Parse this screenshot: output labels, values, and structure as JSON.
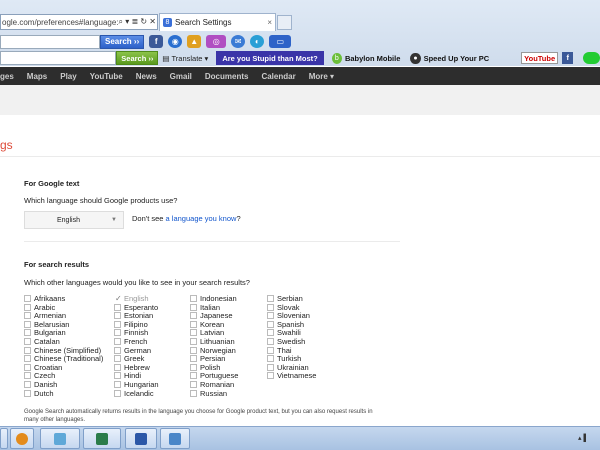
{
  "browser": {
    "address": "ogle.com/preferences#language:",
    "address_icons": "⌕ ▾ ≣ ↻ ✕",
    "tab_title": "Search Settings",
    "tab_close": "×"
  },
  "toolbar1": {
    "search_button": "Search ›› "
  },
  "toolbar2": {
    "search_button": "Search ››",
    "translate": "Translate ▾",
    "stupid_button": "Are you Stupid than Most?",
    "babylon": "Babylon Mobile",
    "speed": "Speed Up Your PC",
    "youtube": "YouTube"
  },
  "google_bar": [
    "ges",
    "Maps",
    "Play",
    "YouTube",
    "News",
    "Gmail",
    "Documents",
    "Calendar",
    "More ▾"
  ],
  "page": {
    "title": "gs",
    "for_google_text": "For Google text",
    "which_language": "Which language should Google products use?",
    "selected_language": "English",
    "dont_see": "Don't see ",
    "dont_see_link": "a language you know",
    "dont_see_end": "?",
    "for_search_results": "For search results",
    "which_other": "Which other languages would you like to see in your search results?",
    "footnote": "Google Search automatically returns results in the language you choose for Google product text, but you can also request results in many other languages."
  },
  "languages": {
    "col1": [
      "Afrikaans",
      "Arabic",
      "Armenian",
      "Belarusian",
      "Bulgarian",
      "Catalan",
      "Chinese (Simplified)",
      "Chinese (Traditional)",
      "Croatian",
      "Czech",
      "Danish",
      "Dutch"
    ],
    "col2": [
      "English",
      "Esperanto",
      "Estonian",
      "Filipino",
      "Finnish",
      "French",
      "German",
      "Greek",
      "Hebrew",
      "Hindi",
      "Hungarian",
      "Icelandic"
    ],
    "col3": [
      "Indonesian",
      "Italian",
      "Japanese",
      "Korean",
      "Latvian",
      "Lithuanian",
      "Norwegian",
      "Persian",
      "Polish",
      "Portuguese",
      "Romanian",
      "Russian"
    ],
    "col4": [
      "Serbian",
      "Slovak",
      "Slovenian",
      "Spanish",
      "Swahili",
      "Swedish",
      "Thai",
      "Turkish",
      "Ukrainian",
      "Vietnamese"
    ],
    "checked": "English"
  },
  "colors": {
    "accent_red": "#dd4b39",
    "link_blue": "#1155cc",
    "gbar_bg": "#2d2d2d"
  },
  "taskbar_icons": [
    "media-player-icon",
    "notes-icon",
    "window-icon",
    "word-icon",
    "screen-icon"
  ]
}
